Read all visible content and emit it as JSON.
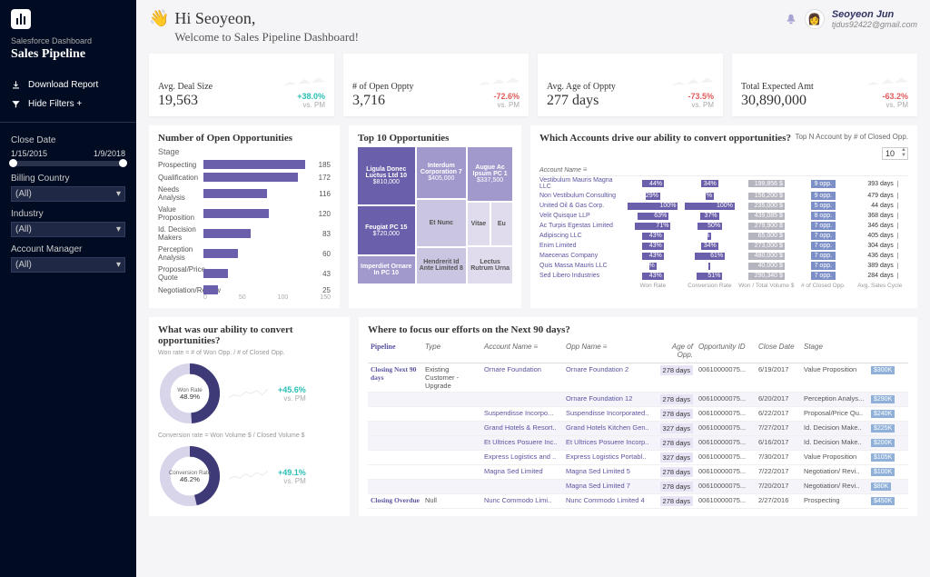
{
  "sidebar": {
    "breadcrumb": "Salesforce Dashboard",
    "title": "Sales Pipeline",
    "download": "Download Report",
    "hideFilters": "Hide Filters +",
    "filters": {
      "closeDate": {
        "label": "Close Date",
        "from": "1/15/2015",
        "to": "1/9/2018"
      },
      "billingCountry": {
        "label": "Billing Country",
        "value": "(All)"
      },
      "industry": {
        "label": "Industry",
        "value": "(All)"
      },
      "accountManager": {
        "label": "Account Manager",
        "value": "(All)"
      }
    }
  },
  "header": {
    "hi": "Hi Seoyeon,",
    "welcome": "Welcome to Sales Pipeline Dashboard!",
    "userName": "Seoyeon Jun",
    "userEmail": "tjdus92422@gmail.com"
  },
  "kpis": [
    {
      "label": "Avg. Deal Size",
      "value": "19,563",
      "delta": "+38.0%",
      "pos": true
    },
    {
      "label": "# of Open Oppty",
      "value": "3,716",
      "delta": "-72.6%",
      "pos": false
    },
    {
      "label": "Avg. Age of Oppty",
      "value": "277 days",
      "delta": "-73.5%",
      "pos": false
    },
    {
      "label": "Total Expected Amt",
      "value": "30,890,000",
      "delta": "-63.2%",
      "pos": false
    }
  ],
  "vsPm": "vs. PM",
  "openOpp": {
    "title": "Number of Open Opportunities",
    "sub": "Stage",
    "axis": [
      "0",
      "50",
      "100",
      "150"
    ]
  },
  "top10": {
    "title": "Top 10 Opportunities"
  },
  "accounts": {
    "title": "Which Accounts drive our ability to convert opportunities?",
    "topNLabel": "Top N Account by # of Closed Opp.",
    "topN": "10",
    "head": [
      "Account Name",
      "",
      "",
      "",
      "",
      ""
    ],
    "foot": [
      "",
      "Won Rate",
      "Conversion Rate",
      "Won / Total Volume $",
      "# of Closed Opp.",
      "Avg. Sales Cycle"
    ]
  },
  "convert": {
    "title": "What was our ability to convert opportunities?",
    "winNote": "Won rate = # of Won Opp. / # of Closed Opp.",
    "winLabel": "Won Rate",
    "winValue": "48.9%",
    "winDelta": "+45.6%",
    "convNote": "Conversion rate = Won Volume $ / Closed Volume $",
    "convLabel": "Conversion Rate",
    "convValue": "46.2%",
    "convDelta": "+49.1%"
  },
  "focus": {
    "title": "Where to focus our efforts on the Next 90 days?",
    "head": [
      "Pipeline",
      "Type",
      "Account Name",
      "Opp Name",
      "Age of Opp.",
      "Opportunity ID",
      "Close Date",
      "Stage",
      ""
    ],
    "groups": [
      "Closing Next 90 days",
      "Closing Overdue"
    ]
  },
  "chart_data": {
    "open_opportunities_by_stage": {
      "type": "bar",
      "categories": [
        "Prospecting",
        "Qualification",
        "Needs Analysis",
        "Value Proposition",
        "Id. Decision Makers",
        "Perception Analysis",
        "Proposal/Price Quote",
        "Negotiation/Review"
      ],
      "values": [
        185,
        172,
        116,
        120,
        83,
        60,
        43,
        25
      ],
      "xlim": [
        0,
        200
      ]
    },
    "top10_opportunities": {
      "type": "treemap",
      "items": [
        {
          "name": "Ligula Donec Luctus Ltd 10",
          "value": "$810,000"
        },
        {
          "name": "Feugiat PC 15",
          "value": "$720,000"
        },
        {
          "name": "Imperdiet Ornare In PC 10",
          "value": ""
        },
        {
          "name": "Interdum Corporation 7",
          "value": "$405,000"
        },
        {
          "name": "Et Nunc",
          "value": ""
        },
        {
          "name": "Hendrerit Id Ante Limited 8",
          "value": ""
        },
        {
          "name": "Augue Ac Ipsum PC 1",
          "value": "$337,500"
        },
        {
          "name": "Vitae",
          "value": ""
        },
        {
          "name": "Eu",
          "value": ""
        },
        {
          "name": "Lectus Rutrum Urna",
          "value": ""
        }
      ]
    },
    "accounts_table": {
      "type": "table",
      "columns": [
        "Account Name",
        "Won Rate",
        "Conversion Rate",
        "Won/Total $",
        "# Closed",
        "Avg Cycle"
      ],
      "rows": [
        [
          "Vestibulum Mauris Magna LLC",
          "44%",
          "34%",
          "199,856 $",
          "9 opp.",
          "393 days"
        ],
        [
          "Non Vestibulum Consulting",
          "29%",
          "17%",
          "156,200 $",
          "9 opp.",
          "479 days"
        ],
        [
          "United Oil & Gas Corp.",
          "100%",
          "100%",
          "235,000 $",
          "5 opp.",
          "44 days"
        ],
        [
          "Velit Quisque LLP",
          "63%",
          "37%",
          "439,085 $",
          "8 opp.",
          "368 days"
        ],
        [
          "Ac Turpis Egestas Limited",
          "71%",
          "50%",
          "279,900 $",
          "7 opp.",
          "346 days"
        ],
        [
          "Adipiscing LLC",
          "43%",
          "7%",
          "65,000 $",
          "7 opp.",
          "405 days"
        ],
        [
          "Enim Limited",
          "43%",
          "34%",
          "273,000 $",
          "7 opp.",
          "304 days"
        ],
        [
          "Maecenas Company",
          "43%",
          "61%",
          "480,000 $",
          "7 opp.",
          "436 days"
        ],
        [
          "Quis Massa Mauris LLC",
          "14%",
          "0%",
          "40,000 $",
          "7 opp.",
          "389 days"
        ],
        [
          "Sed Libero Industries",
          "43%",
          "51%",
          "290,340 $",
          "7 opp.",
          "284 days"
        ]
      ]
    },
    "win_rate_donut": {
      "type": "pie",
      "values": [
        48.9,
        51.1
      ]
    },
    "conversion_rate_donut": {
      "type": "pie",
      "values": [
        46.2,
        53.8
      ]
    },
    "focus_table": {
      "type": "table",
      "columns": [
        "Pipeline",
        "Type",
        "Account",
        "Opp",
        "Age",
        "OppID",
        "CloseDate",
        "Stage",
        "Amount"
      ],
      "rows": [
        [
          "Closing Next 90 days",
          "Existing Customer - Upgrade",
          "Ornare Foundation",
          "Ornare Foundation 2",
          "278 days",
          "00610000075...",
          "6/19/2017",
          "Value Proposition",
          "$300K"
        ],
        [
          "",
          "",
          "",
          "Ornare Foundation 12",
          "278 days",
          "00610000075...",
          "6/20/2017",
          "Perception Analys...",
          "$290K"
        ],
        [
          "",
          "",
          "Suspendisse Incorpo...",
          "Suspendisse Incorporated..",
          "278 days",
          "00610000075...",
          "6/22/2017",
          "Proposal/Price Qu..",
          "$240K"
        ],
        [
          "",
          "",
          "Grand Hotels & Resort..",
          "Grand Hotels Kitchen Gen..",
          "327 days",
          "00610000075...",
          "7/27/2017",
          "Id. Decision Make..",
          "$225K"
        ],
        [
          "",
          "",
          "Et Ultrices Posuere Inc..",
          "Et Ultrices Posuere Incorp..",
          "278 days",
          "00610000075...",
          "6/16/2017",
          "Id. Decision Make..",
          "$200K"
        ],
        [
          "",
          "",
          "Express Logistics and ..",
          "Express Logistics Portabl..",
          "327 days",
          "00610000075...",
          "7/30/2017",
          "Value Proposition",
          "$105K"
        ],
        [
          "",
          "",
          "Magna Sed Limited",
          "Magna Sed Limited 5",
          "278 days",
          "00610000075...",
          "7/22/2017",
          "Negotiation/ Revi..",
          "$100K"
        ],
        [
          "",
          "",
          "",
          "Magna Sed Limited 7",
          "278 days",
          "00610000075...",
          "7/20/2017",
          "Negotiation/ Revi..",
          "$80K"
        ],
        [
          "Closing Overdue",
          "Null",
          "Nunc Commodo Limi..",
          "Nunc Commodo Limited 4",
          "278 days",
          "00610000075...",
          "2/27/2016",
          "Prospecting",
          "$450K"
        ]
      ]
    }
  }
}
